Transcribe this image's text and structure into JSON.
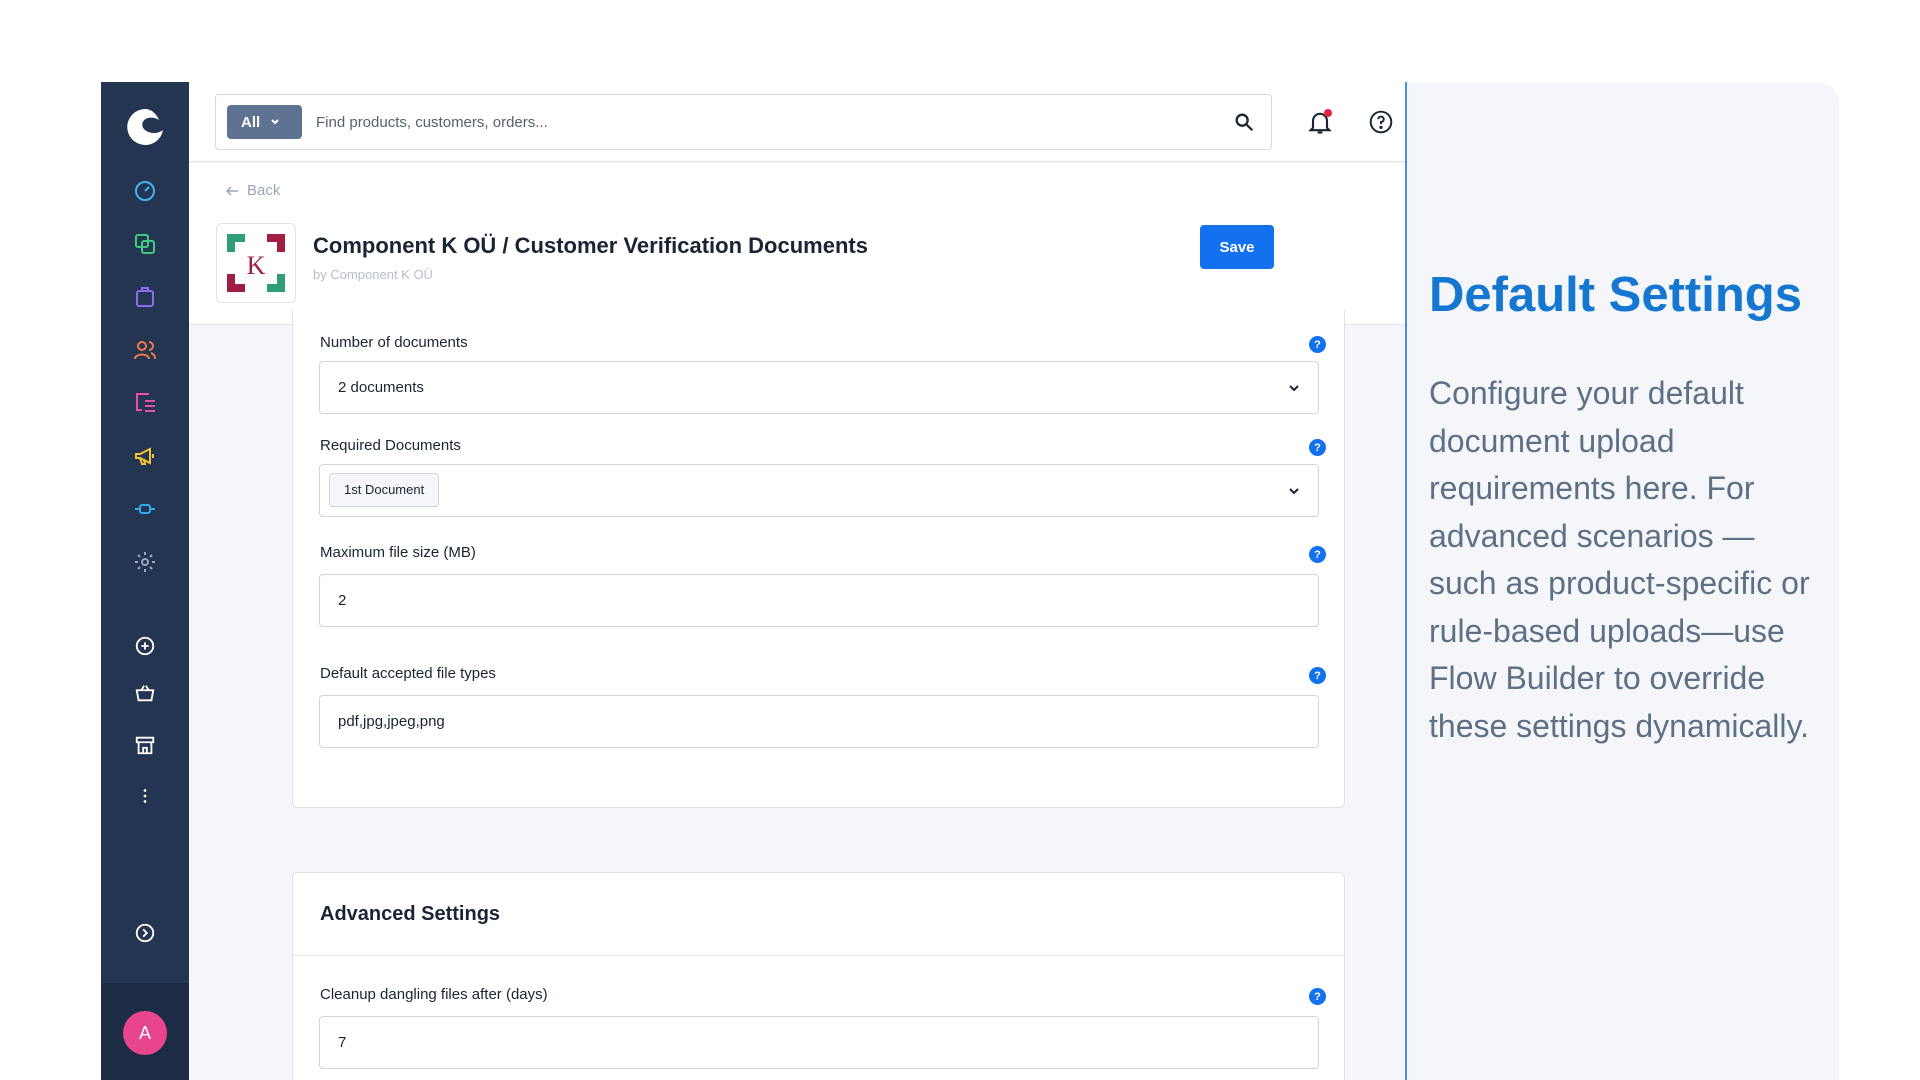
{
  "search": {
    "type_label": "All",
    "placeholder": "Find products, customers, orders..."
  },
  "sidebar": {
    "items": [
      {
        "icon": "dashboard-icon",
        "color": "#43b3ee"
      },
      {
        "icon": "catalog-icon",
        "color": "#3ecb7f"
      },
      {
        "icon": "orders-icon",
        "color": "#8d6cf2"
      },
      {
        "icon": "customers-icon",
        "color": "#f27a4a"
      },
      {
        "icon": "content-icon",
        "color": "#ea4fa5"
      },
      {
        "icon": "marketing-icon",
        "color": "#f5c330"
      },
      {
        "icon": "extensions-icon",
        "color": "#35a5f0"
      },
      {
        "icon": "settings-icon",
        "color": "#9aa8bd"
      },
      {
        "icon": "add-sales-channel-icon",
        "color": "#ffffff"
      },
      {
        "icon": "basket-icon",
        "color": "#ffffff"
      },
      {
        "icon": "storefront-icon",
        "color": "#ffffff"
      },
      {
        "icon": "more-icon",
        "color": "#ffffff"
      },
      {
        "icon": "collapse-icon",
        "color": "#ffffff"
      }
    ],
    "avatar_letter": "A",
    "avatar_color": "#e9458f"
  },
  "header": {
    "back_label": "Back",
    "title": "Component K OÜ / Customer Verification Documents",
    "subtitle": "by Component K OÜ",
    "save_label": "Save",
    "logo_letter": "K"
  },
  "settings": {
    "fields": [
      {
        "label": "Number of documents",
        "value": "2 documents",
        "kind": "select"
      },
      {
        "label": "Required Documents",
        "tag": "1st Document",
        "kind": "multiselect"
      },
      {
        "label": "Maximum file size (MB)",
        "value": "2",
        "kind": "input"
      },
      {
        "label": "Default accepted file types",
        "value": "pdf,jpg,jpeg,png",
        "kind": "input"
      }
    ]
  },
  "advanced": {
    "title": "Advanced Settings",
    "fields": [
      {
        "label": "Cleanup dangling files after (days)",
        "value": "7",
        "kind": "input"
      }
    ]
  },
  "help_mark": "?",
  "panel": {
    "title": "Default Settings",
    "text": "Configure your default document upload requirements here. For advanced scenarios — such as product-specific or rule-based uploads—use Flow Builder to override these settings dynamically."
  },
  "colors": {
    "accent": "#1371ef",
    "panel_title": "#1577d0",
    "sidebar": "#243552",
    "notification_dot": "#e5243f"
  }
}
